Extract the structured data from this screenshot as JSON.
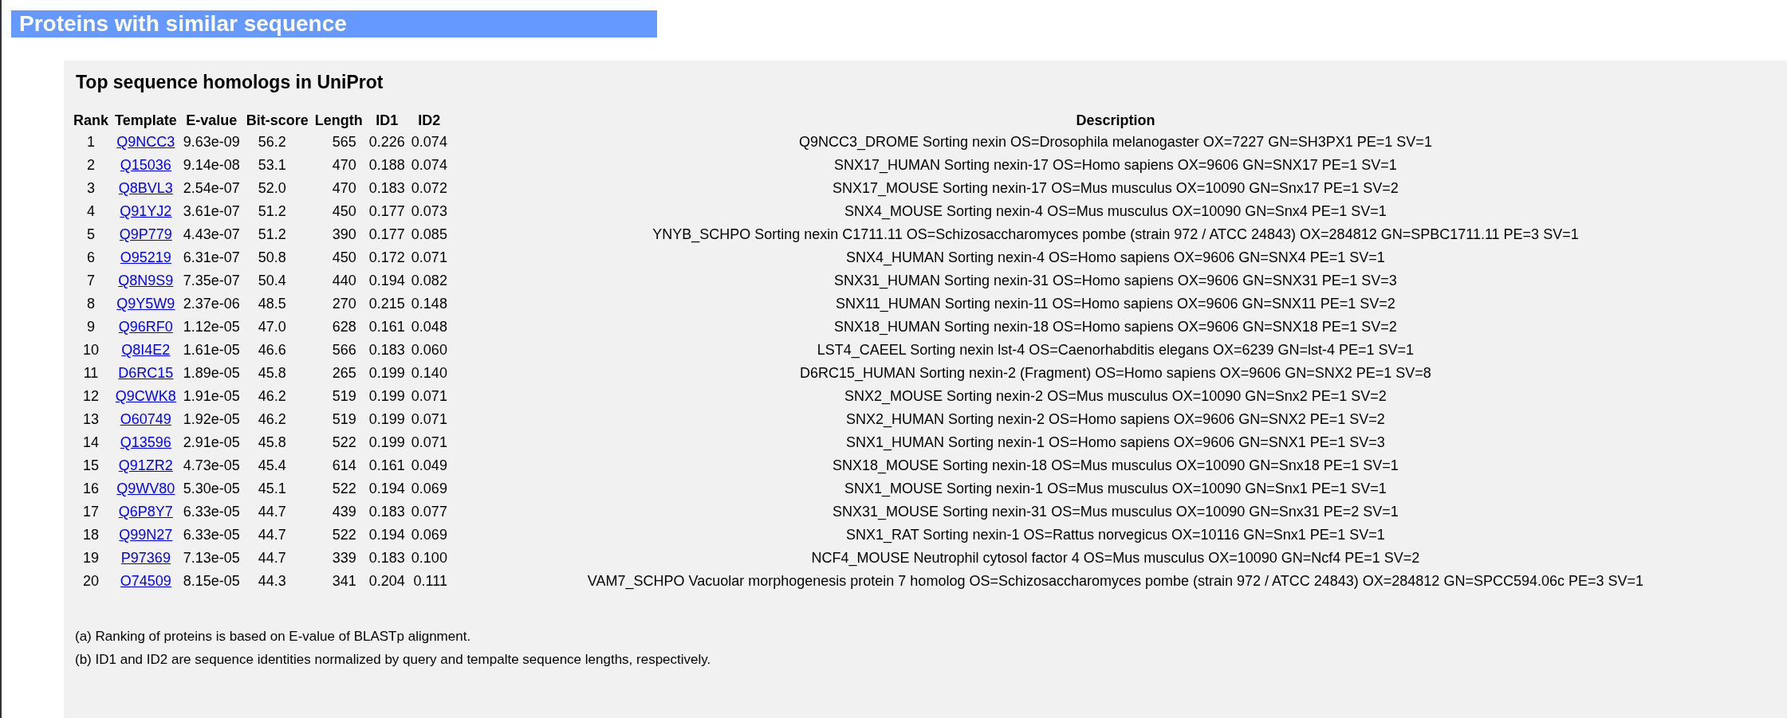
{
  "header": {
    "title": "Proteins with similar sequence"
  },
  "panel": {
    "title": "Top sequence homologs in UniProt",
    "columns": [
      "Rank",
      "Template",
      "E-value",
      "Bit-score",
      "Length",
      "ID1",
      "ID2",
      "Description"
    ],
    "rows": [
      {
        "rank": "1",
        "template": "Q9NCC3",
        "evalue": "9.63e-09",
        "bitscore": "56.2",
        "length": "565",
        "id1": "0.226",
        "id2": "0.074",
        "description": "Q9NCC3_DROME Sorting nexin OS=Drosophila melanogaster OX=7227 GN=SH3PX1 PE=1 SV=1"
      },
      {
        "rank": "2",
        "template": "Q15036",
        "evalue": "9.14e-08",
        "bitscore": "53.1",
        "length": "470",
        "id1": "0.188",
        "id2": "0.074",
        "description": "SNX17_HUMAN Sorting nexin-17 OS=Homo sapiens OX=9606 GN=SNX17 PE=1 SV=1"
      },
      {
        "rank": "3",
        "template": "Q8BVL3",
        "evalue": "2.54e-07",
        "bitscore": "52.0",
        "length": "470",
        "id1": "0.183",
        "id2": "0.072",
        "description": "SNX17_MOUSE Sorting nexin-17 OS=Mus musculus OX=10090 GN=Snx17 PE=1 SV=2"
      },
      {
        "rank": "4",
        "template": "Q91YJ2",
        "evalue": "3.61e-07",
        "bitscore": "51.2",
        "length": "450",
        "id1": "0.177",
        "id2": "0.073",
        "description": "SNX4_MOUSE Sorting nexin-4 OS=Mus musculus OX=10090 GN=Snx4 PE=1 SV=1"
      },
      {
        "rank": "5",
        "template": "Q9P779",
        "evalue": "4.43e-07",
        "bitscore": "51.2",
        "length": "390",
        "id1": "0.177",
        "id2": "0.085",
        "description": "YNYB_SCHPO Sorting nexin C1711.11 OS=Schizosaccharomyces pombe (strain 972 / ATCC 24843) OX=284812 GN=SPBC1711.11 PE=3 SV=1"
      },
      {
        "rank": "6",
        "template": "O95219",
        "evalue": "6.31e-07",
        "bitscore": "50.8",
        "length": "450",
        "id1": "0.172",
        "id2": "0.071",
        "description": "SNX4_HUMAN Sorting nexin-4 OS=Homo sapiens OX=9606 GN=SNX4 PE=1 SV=1"
      },
      {
        "rank": "7",
        "template": "Q8N9S9",
        "evalue": "7.35e-07",
        "bitscore": "50.4",
        "length": "440",
        "id1": "0.194",
        "id2": "0.082",
        "description": "SNX31_HUMAN Sorting nexin-31 OS=Homo sapiens OX=9606 GN=SNX31 PE=1 SV=3"
      },
      {
        "rank": "8",
        "template": "Q9Y5W9",
        "evalue": "2.37e-06",
        "bitscore": "48.5",
        "length": "270",
        "id1": "0.215",
        "id2": "0.148",
        "description": "SNX11_HUMAN Sorting nexin-11 OS=Homo sapiens OX=9606 GN=SNX11 PE=1 SV=2"
      },
      {
        "rank": "9",
        "template": "Q96RF0",
        "evalue": "1.12e-05",
        "bitscore": "47.0",
        "length": "628",
        "id1": "0.161",
        "id2": "0.048",
        "description": "SNX18_HUMAN Sorting nexin-18 OS=Homo sapiens OX=9606 GN=SNX18 PE=1 SV=2"
      },
      {
        "rank": "10",
        "template": "Q8I4E2",
        "evalue": "1.61e-05",
        "bitscore": "46.6",
        "length": "566",
        "id1": "0.183",
        "id2": "0.060",
        "description": "LST4_CAEEL Sorting nexin lst-4 OS=Caenorhabditis elegans OX=6239 GN=lst-4 PE=1 SV=1"
      },
      {
        "rank": "11",
        "template": "D6RC15",
        "evalue": "1.89e-05",
        "bitscore": "45.8",
        "length": "265",
        "id1": "0.199",
        "id2": "0.140",
        "description": "D6RC15_HUMAN Sorting nexin-2 (Fragment) OS=Homo sapiens OX=9606 GN=SNX2 PE=1 SV=8"
      },
      {
        "rank": "12",
        "template": "Q9CWK8",
        "evalue": "1.91e-05",
        "bitscore": "46.2",
        "length": "519",
        "id1": "0.199",
        "id2": "0.071",
        "description": "SNX2_MOUSE Sorting nexin-2 OS=Mus musculus OX=10090 GN=Snx2 PE=1 SV=2"
      },
      {
        "rank": "13",
        "template": "O60749",
        "evalue": "1.92e-05",
        "bitscore": "46.2",
        "length": "519",
        "id1": "0.199",
        "id2": "0.071",
        "description": "SNX2_HUMAN Sorting nexin-2 OS=Homo sapiens OX=9606 GN=SNX2 PE=1 SV=2"
      },
      {
        "rank": "14",
        "template": "Q13596",
        "evalue": "2.91e-05",
        "bitscore": "45.8",
        "length": "522",
        "id1": "0.199",
        "id2": "0.071",
        "description": "SNX1_HUMAN Sorting nexin-1 OS=Homo sapiens OX=9606 GN=SNX1 PE=1 SV=3"
      },
      {
        "rank": "15",
        "template": "Q91ZR2",
        "evalue": "4.73e-05",
        "bitscore": "45.4",
        "length": "614",
        "id1": "0.161",
        "id2": "0.049",
        "description": "SNX18_MOUSE Sorting nexin-18 OS=Mus musculus OX=10090 GN=Snx18 PE=1 SV=1"
      },
      {
        "rank": "16",
        "template": "Q9WV80",
        "evalue": "5.30e-05",
        "bitscore": "45.1",
        "length": "522",
        "id1": "0.194",
        "id2": "0.069",
        "description": "SNX1_MOUSE Sorting nexin-1 OS=Mus musculus OX=10090 GN=Snx1 PE=1 SV=1"
      },
      {
        "rank": "17",
        "template": "Q6P8Y7",
        "evalue": "6.33e-05",
        "bitscore": "44.7",
        "length": "439",
        "id1": "0.183",
        "id2": "0.077",
        "description": "SNX31_MOUSE Sorting nexin-31 OS=Mus musculus OX=10090 GN=Snx31 PE=2 SV=1"
      },
      {
        "rank": "18",
        "template": "Q99N27",
        "evalue": "6.33e-05",
        "bitscore": "44.7",
        "length": "522",
        "id1": "0.194",
        "id2": "0.069",
        "description": "SNX1_RAT Sorting nexin-1 OS=Rattus norvegicus OX=10116 GN=Snx1 PE=1 SV=1"
      },
      {
        "rank": "19",
        "template": "P97369",
        "evalue": "7.13e-05",
        "bitscore": "44.7",
        "length": "339",
        "id1": "0.183",
        "id2": "0.100",
        "description": "NCF4_MOUSE Neutrophil cytosol factor 4 OS=Mus musculus OX=10090 GN=Ncf4 PE=1 SV=2"
      },
      {
        "rank": "20",
        "template": "O74509",
        "evalue": "8.15e-05",
        "bitscore": "44.3",
        "length": "341",
        "id1": "0.204",
        "id2": "0.111",
        "description": "VAM7_SCHPO Vacuolar morphogenesis protein 7 homolog OS=Schizosaccharomyces pombe (strain 972 / ATCC 24843) OX=284812 GN=SPCC594.06c PE=3 SV=1"
      }
    ],
    "notes": [
      "(a) Ranking of proteins is based on E-value of BLASTp alignment.",
      "(b) ID1 and ID2 are sequence identities normalized by query and tempalte sequence lengths, respectively."
    ]
  }
}
